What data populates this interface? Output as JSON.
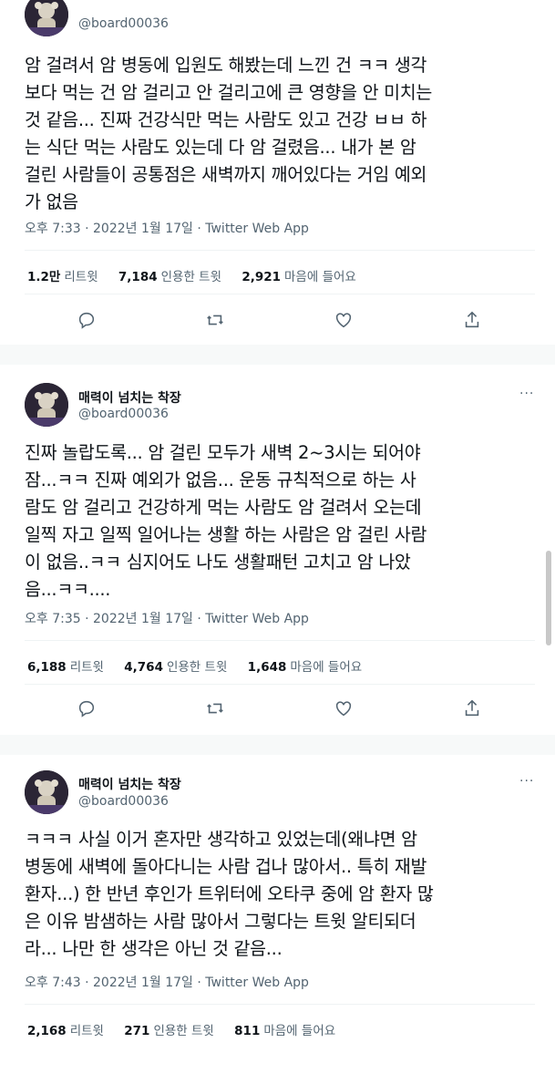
{
  "tweets": [
    {
      "name": "",
      "handle": "@board00036",
      "text": "암 걸려서 암 병동에 입원도 해봤는데 느낀 건 ㅋㅋ 생각\n보다 먹는 건 암 걸리고 안 걸리고에 큰 영향을 안 미치는\n것 같음... 진짜 건강식만 먹는 사람도 있고 건강 ㅂㅂ 하\n는 식단 먹는 사람도 있는데 다 암 걸렸음... 내가 본 암\n걸린 사람들이 공통점은 새벽까지 깨어있다는 거임 예외\n가 없음",
      "meta": "오후 7:33 · 2022년 1월 17일 · Twitter Web App",
      "retweets_count": "1.2만",
      "retweets_label": "리트윗",
      "quotes_count": "7,184",
      "quotes_label": "인용한 트윗",
      "likes_count": "2,921",
      "likes_label": "마음에 들어요"
    },
    {
      "name": "매력이 넘치는 착장",
      "handle": "@board00036",
      "text": "진짜 놀랍도록... 암 걸린 모두가 새벽 2~3시는 되어야\n잠...ㅋㅋ 진짜 예외가 없음... 운동 규칙적으로 하는 사\n람도 암 걸리고 건강하게 먹는 사람도 암 걸려서 오는데\n일찍 자고 일찍 일어나는 생활 하는 사람은 암 걸린 사람\n이 없음..ㅋㅋ 심지어도 나도 생활패턴 고치고 암 나았\n음...ㅋㅋ....",
      "meta": "오후 7:35 · 2022년 1월 17일 · Twitter Web App",
      "retweets_count": "6,188",
      "retweets_label": "리트윗",
      "quotes_count": "4,764",
      "quotes_label": "인용한 트윗",
      "likes_count": "1,648",
      "likes_label": "마음에 들어요"
    },
    {
      "name": "매력이 넘치는 착장",
      "handle": "@board00036",
      "text": "ㅋㅋㅋ 사실 이거 혼자만 생각하고 있었는데(왜냐면 암\n병동에 새벽에 돌아다니는 사람 겁나 많아서.. 특히 재발\n환자...) 한 반년 후인가 트위터에 오타쿠 중에 암 환자 많\n은 이유 밤샘하는 사람 많아서 그렇다는 트윗 알티되더\n라... 나만 한 생각은 아닌 것 같음...",
      "meta": "오후 7:43 · 2022년 1월 17일 · Twitter Web App",
      "retweets_count": "2,168",
      "retweets_label": "리트윗",
      "quotes_count": "271",
      "quotes_label": "인용한 트윗",
      "likes_count": "811",
      "likes_label": "마음에 들어요"
    }
  ],
  "more_icon": "···",
  "icons": [
    "reply-icon",
    "retweet-icon",
    "like-icon",
    "share-icon"
  ],
  "colors": {
    "text": "#0f1419",
    "secondary": "#536471",
    "divider": "#eff3f4"
  }
}
